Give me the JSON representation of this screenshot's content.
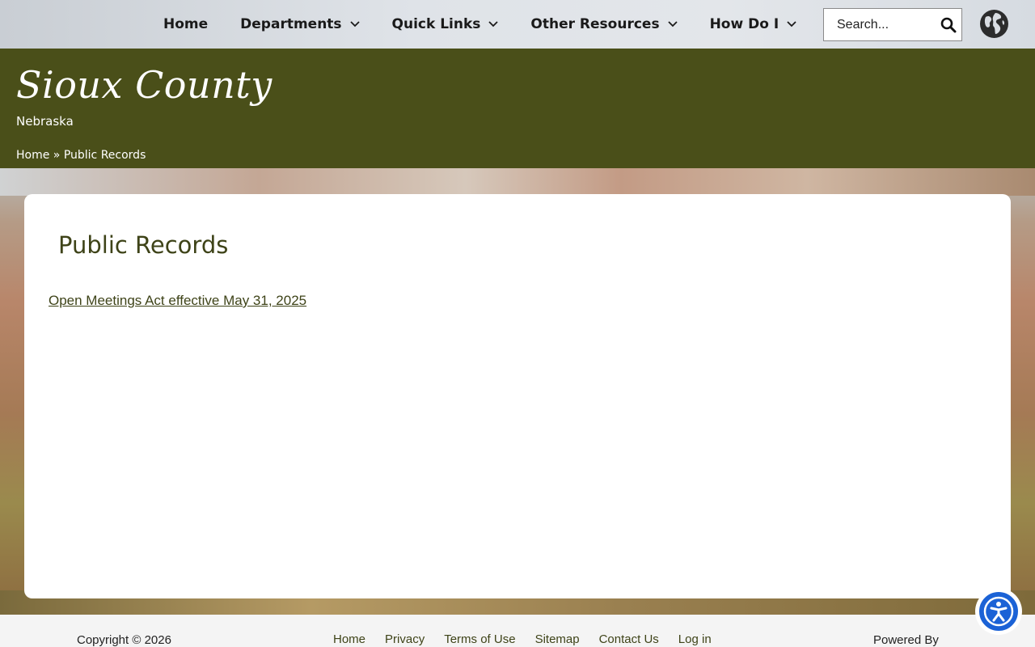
{
  "nav": {
    "items": [
      {
        "label": "Home",
        "has_dropdown": false
      },
      {
        "label": "Departments",
        "has_dropdown": true
      },
      {
        "label": "Quick Links",
        "has_dropdown": true
      },
      {
        "label": "Other Resources",
        "has_dropdown": true
      },
      {
        "label": "How Do I",
        "has_dropdown": true
      }
    ],
    "search_placeholder": "Search...",
    "search_icon": "search-icon",
    "globe_icon": "globe-icon"
  },
  "header": {
    "title": "Sioux County",
    "subtitle": "Nebraska",
    "breadcrumb": {
      "home": "Home",
      "separator": "»",
      "current": "Public Records"
    },
    "bg_color": "#4a4f19"
  },
  "main": {
    "page_title": "Public Records",
    "links": [
      "Open Meetings Act effective May 31, 2025"
    ]
  },
  "footer": {
    "copyright": "Copyright © 2026",
    "links": [
      "Home",
      "Privacy",
      "Terms of Use",
      "Sitemap",
      "Contact Us",
      "Log in"
    ],
    "powered_by": "Powered By"
  },
  "accessibility": {
    "icon": "accessibility-icon",
    "color": "#1b62d6"
  }
}
